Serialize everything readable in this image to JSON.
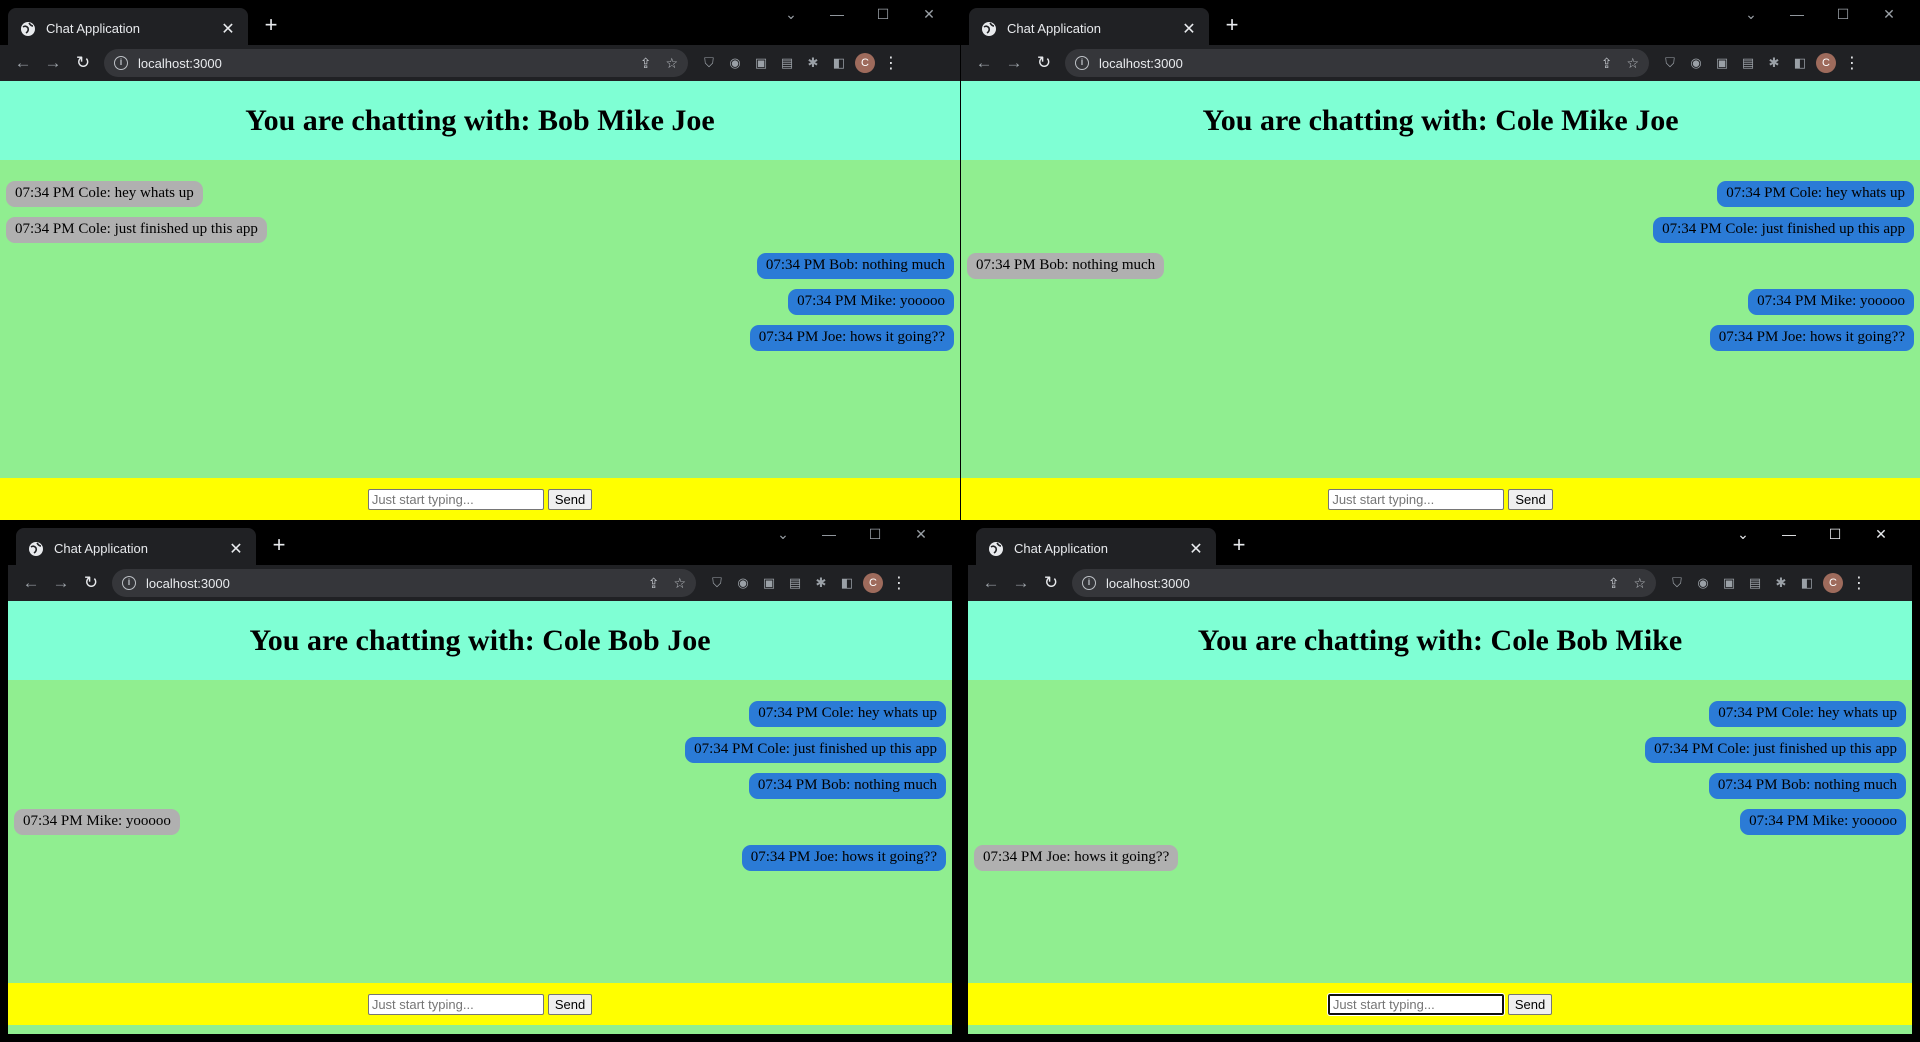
{
  "colors": {
    "header_bg": "#7fffd4",
    "chat_bg": "#90ee90",
    "footer_bg": "#ffff00",
    "outgoing_bubble": "#2b7bd6",
    "incoming_bubble": "#b0b0b0",
    "browser_chrome": "#202124"
  },
  "windows": [
    {
      "tab_title": "Chat Application",
      "url": "localhost:3000",
      "avatar_letter": "C",
      "heading": "You are chatting with: Bob Mike Joe",
      "messages": [
        {
          "text": "07:34 PM Cole: hey whats up",
          "side": "in"
        },
        {
          "text": "07:34 PM Cole: just finished up this app",
          "side": "in"
        },
        {
          "text": "07:34 PM Bob: nothing much",
          "side": "out"
        },
        {
          "text": "07:34 PM Mike: yooooo",
          "side": "out"
        },
        {
          "text": "07:34 PM Joe: hows it going??",
          "side": "out"
        }
      ],
      "input_placeholder": "Just start typing...",
      "send_label": "Send"
    },
    {
      "tab_title": "Chat Application",
      "url": "localhost:3000",
      "avatar_letter": "C",
      "heading": "You are chatting with: Cole Mike Joe",
      "messages": [
        {
          "text": "07:34 PM Cole: hey whats up",
          "side": "out"
        },
        {
          "text": "07:34 PM Cole: just finished up this app",
          "side": "out"
        },
        {
          "text": "07:34 PM Bob: nothing much",
          "side": "in"
        },
        {
          "text": "07:34 PM Mike: yooooo",
          "side": "out"
        },
        {
          "text": "07:34 PM Joe: hows it going??",
          "side": "out"
        }
      ],
      "input_placeholder": "Just start typing...",
      "send_label": "Send"
    },
    {
      "tab_title": "Chat Application",
      "url": "localhost:3000",
      "avatar_letter": "C",
      "heading": "You are chatting with: Cole Bob Joe",
      "messages": [
        {
          "text": "07:34 PM Cole: hey whats up",
          "side": "out"
        },
        {
          "text": "07:34 PM Cole: just finished up this app",
          "side": "out"
        },
        {
          "text": "07:34 PM Bob: nothing much",
          "side": "out"
        },
        {
          "text": "07:34 PM Mike: yooooo",
          "side": "in"
        },
        {
          "text": "07:34 PM Joe: hows it going??",
          "side": "out"
        }
      ],
      "input_placeholder": "Just start typing...",
      "send_label": "Send"
    },
    {
      "tab_title": "Chat Application",
      "url": "localhost:3000",
      "avatar_letter": "C",
      "heading": "You are chatting with: Cole Bob Mike",
      "messages": [
        {
          "text": "07:34 PM Cole: hey whats up",
          "side": "out"
        },
        {
          "text": "07:34 PM Cole: just finished up this app",
          "side": "out"
        },
        {
          "text": "07:34 PM Bob: nothing much",
          "side": "out"
        },
        {
          "text": "07:34 PM Mike: yooooo",
          "side": "out"
        },
        {
          "text": "07:34 PM Joe: hows it going??",
          "side": "in"
        }
      ],
      "input_placeholder": "Just start typing...",
      "send_label": "Send",
      "input_focused": true
    }
  ]
}
